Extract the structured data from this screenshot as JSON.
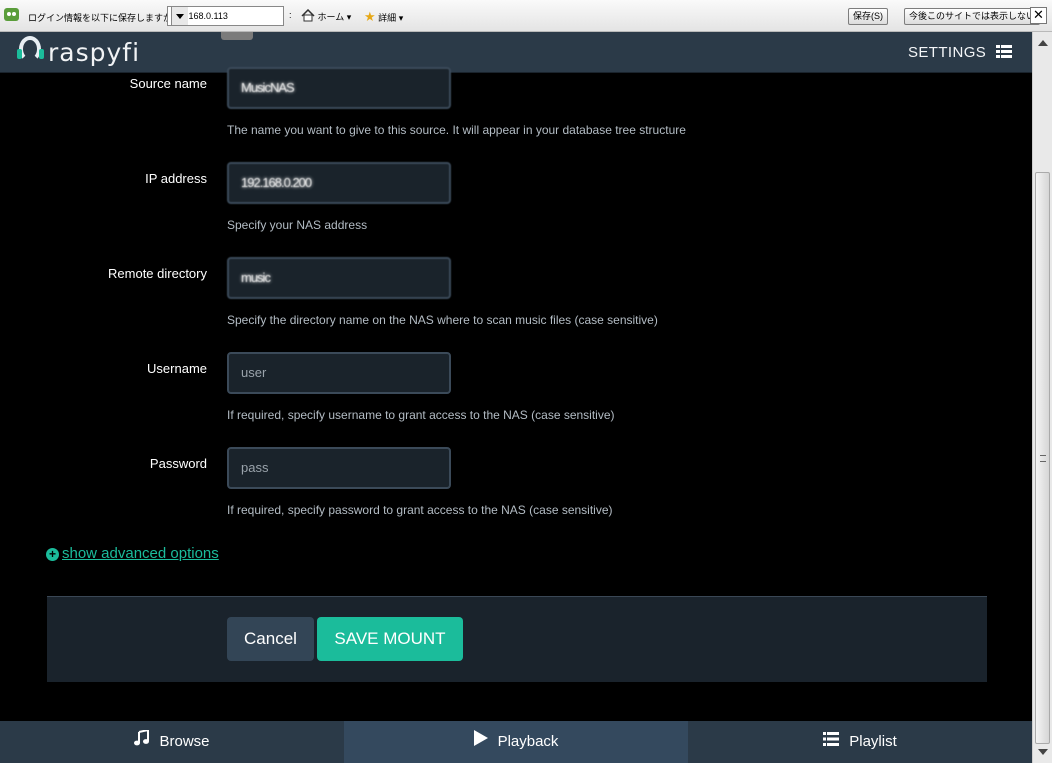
{
  "browser_bar": {
    "prompt": "ログイン情報を以下に保存しますか:",
    "address": "192.168.0.113",
    "home_label": "ホーム",
    "detail_label": "詳細",
    "save_label": "保存(S)",
    "never_label": "今後このサイトでは表示しない",
    "close_label": "✕"
  },
  "header": {
    "logo_text": "raspyfi",
    "settings_label": "SETTINGS"
  },
  "form": {
    "fields": [
      {
        "label": "Source name",
        "value": "MusicNAS",
        "help": "The name you want to give to this source. It will appear in your database tree structure"
      },
      {
        "label": "IP address",
        "value": "192.168.0.200",
        "help": "Specify your NAS address"
      },
      {
        "label": "Remote directory",
        "value": "music",
        "help": "Specify the directory name on the NAS where to scan music files (case sensitive)"
      },
      {
        "label": "Username",
        "placeholder": "user",
        "help": "If required, specify username to grant access to the NAS (case sensitive)"
      },
      {
        "label": "Password",
        "placeholder": "pass",
        "help": "If required, specify password to grant access to the NAS (case sensitive)"
      }
    ],
    "advanced_label": "show advanced options",
    "cancel_label": "Cancel",
    "save_label": "SAVE MOUNT"
  },
  "footer": {
    "tabs": [
      {
        "label": "Browse",
        "icon": "music-note-icon"
      },
      {
        "label": "Playback",
        "icon": "play-icon",
        "active": true
      },
      {
        "label": "Playlist",
        "icon": "list-icon"
      }
    ]
  },
  "colors": {
    "accent": "#1bbc9b",
    "header_bg": "#2b3a48",
    "active_tab_bg": "#34495e",
    "input_bg": "#1a232b"
  }
}
